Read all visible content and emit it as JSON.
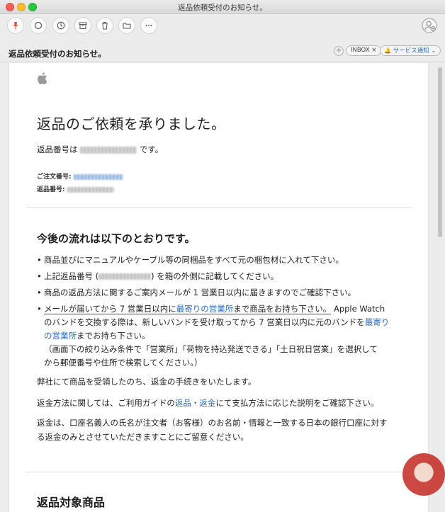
{
  "window": {
    "title": "返品依頼受付のお知らせ。"
  },
  "toolbar": {
    "icons": [
      "pin-icon",
      "circle-icon",
      "clock-icon",
      "archive-icon",
      "trash-icon",
      "folder-icon",
      "more-icon",
      "account-icon"
    ]
  },
  "header": {
    "subject": "返品依頼受付のお知らせ。",
    "inbox_tag": "INBOX ×",
    "notice_tag": "サービス通知 ⌄",
    "plus": "+"
  },
  "email": {
    "headline": "返品のご依頼を承りました。",
    "return_number_prefix": "返品番号は",
    "return_number_suffix": "です。",
    "order_number_label": "ご注文番号:",
    "return_number_label": "返品番号:",
    "flow_heading": "今後の流れは以下のとおりです。",
    "bullets": {
      "b1": "商品並びにマニュアルやケーブル等の同梱品をすべて元の梱包材に入れて下さい。",
      "b2_prefix": "上記返品番号 (",
      "b2_suffix": ") を箱の外側に記載してください。",
      "b3": "商品の返品方法に関するご案内メールが 1 営業日以内に届きますのでご確認下さい。",
      "b4_part1": "メールが届いてから ",
      "b4_part2": "7 営業日以内",
      "b4_part3": "に",
      "b4_link1": "最寄りの営業所",
      "b4_part4": "まで商品をお持ち下さい。",
      "b4_part5": " Apple Watch",
      "b4_line2_a": "のバンドを交換する際は、新しいバンドを受け取ってから 7 営業日以内に元のバンドを",
      "b4_link2": "最寄り",
      "b4_line3_link": "の営業所",
      "b4_line3_rest": "までお持ち下さい。",
      "b4_line4": "（画面下の絞り込み条件で「営業所」「荷物を持込発送できる」「土日祝日営業」を選択して",
      "b4_line5": "から郵便番号や住所で検索してください。）"
    },
    "para1": "弊社にて商品を受領したのち、返金の手続きをいたします。",
    "para2_prefix": "返金方法に関しては、ご利用ガイドの",
    "para2_link": "返品・返金",
    "para2_suffix": "にて支払方法に応じた説明をご確認下さい。",
    "para3_line1": "返金は、口座名義人の氏名が注文者（お客様）のお名前・情報と一致する日本の銀行口座に対す",
    "para3_line2": "る返金のみとさせていただきますことにご留意ください。",
    "items_heading": "返品対象商品"
  },
  "colors": {
    "link": "#2c6bb8",
    "underline": "#c8242b",
    "pin": "#e0553a"
  }
}
